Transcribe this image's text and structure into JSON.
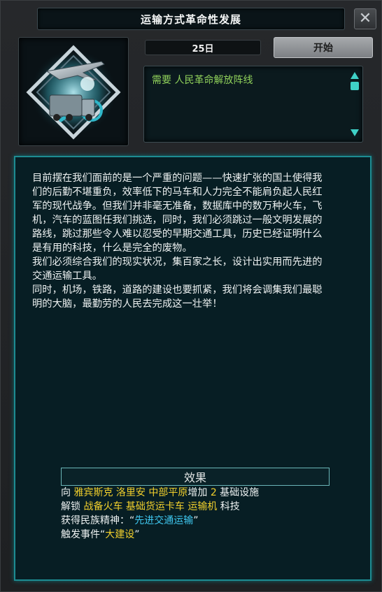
{
  "window": {
    "title": "运输方式革命性发展",
    "close_icon": "close-icon"
  },
  "focus": {
    "icon": "truck-plane-icon",
    "duration": "25日",
    "start_label": "开始",
    "requirement": "需要 人民革命解放阵线"
  },
  "description": [
    "目前摆在我们面前的是一个严重的问题——快速扩张的国土使得我",
    "们的后勤不堪重负，效率低下的马车和人力完全不能肩负起人民红",
    "军的现代战争。但我们并非毫无准备，数据库中的数万种火车，飞",
    "机，汽车的蓝图任我们挑选，同时，我们必须跳过一般文明发展的",
    "路线，跳过那些令人难以忍受的早期交通工具，历史已经证明什么",
    "是有用的科技，什么是完全的废物。",
    "我们必须综合我们的现实状况，集百家之长，设计出实用而先进的",
    "交通运输工具。",
    "同时，机场，铁路，道路的建设也要抓紧，我们将会调集我们最聪",
    "明的大脑，最勤劳的人民去完成这一壮举！"
  ],
  "effects": {
    "header": "效果",
    "line1": {
      "prefix": "向 ",
      "states": "雅宾斯克 洛里安 中部平原",
      "mid": "增加 ",
      "amount": "2",
      "suffix": " 基础设施"
    },
    "line2": {
      "prefix": "解锁 ",
      "techs": "战备火车 基础货运卡车 运输机",
      "suffix": " 科技"
    },
    "line3": {
      "prefix": "获得民族精神：“",
      "spirit": "先进交通运输",
      "suffix": "”"
    },
    "line4": {
      "prefix": "触发事件“",
      "event": "大建设",
      "suffix": "”"
    }
  },
  "colors": {
    "accent": "#1d8c92",
    "requirement": "#8fd05a",
    "highlight": "#f2d02c",
    "spirit": "#3fc8f0"
  }
}
